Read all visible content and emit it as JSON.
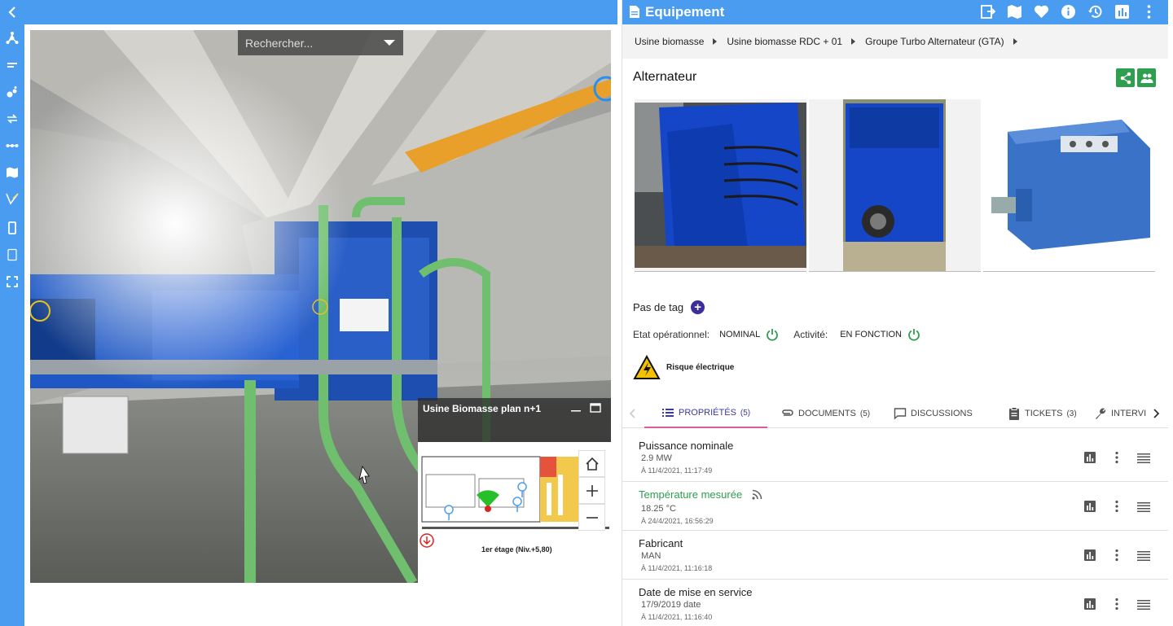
{
  "viewer": {
    "search_placeholder": "Rechercher...",
    "minimap_title": "Usine Biomasse plan n+1",
    "minimap_caption": "1er étage  (Niv.+5,80)"
  },
  "panel": {
    "title": "Equipement",
    "breadcrumb": [
      "Usine biomasse",
      "Usine biomasse RDC + 01",
      "Groupe Turbo Alternateur (GTA)"
    ],
    "equipment_name": "Alternateur",
    "tag_label": "Pas de tag",
    "state_label": "Etat opérationnel:",
    "state_value": "NOMINAL",
    "activity_label": "Activité:",
    "activity_value": "EN FONCTION",
    "risk_label": "Risque électrique",
    "tabs": [
      {
        "label": "PROPRIÉTÉS",
        "count": "(5)"
      },
      {
        "label": "DOCUMENTS",
        "count": "(5)"
      },
      {
        "label": "DISCUSSIONS",
        "count": ""
      },
      {
        "label": "TICKETS",
        "count": "(3)"
      },
      {
        "label": "INTERVI",
        "count": ""
      }
    ],
    "properties": [
      {
        "name": "Puissance nominale",
        "value": "2.9 MW",
        "date": "À 11/4/2021, 11:17:49"
      },
      {
        "name": "Température mesurée",
        "value": "18.25 °C",
        "date": "À 24/4/2021, 16:56:29"
      },
      {
        "name": "Fabricant",
        "value": "MAN",
        "date": "À 11/4/2021, 11:16:18"
      },
      {
        "name": "Date de mise en service",
        "value": "17/9/2019 date",
        "date": "À 11/4/2021, 11:16:40"
      }
    ]
  },
  "colors": {
    "primary": "#4a9cf0",
    "accent_green": "#2e9e4f",
    "active_tab_underline": "#d65aa0",
    "add_button": "#3a2e9c"
  }
}
